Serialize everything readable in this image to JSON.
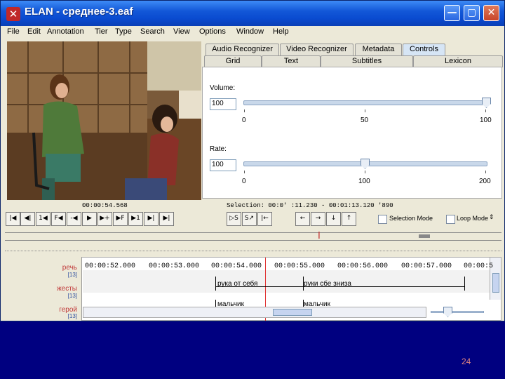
{
  "window": {
    "title": "ELAN - среднее-3.eaf",
    "app_icon": "elan-icon"
  },
  "window_controls": {
    "minimize": "—",
    "maximize": "▢",
    "close": "✕"
  },
  "menu": [
    "File",
    "Edit",
    "Annotation",
    "Tier",
    "Type",
    "Search",
    "View",
    "Options",
    "Window",
    "Help"
  ],
  "tabs_row1": [
    "Audio Recognizer",
    "Video Recognizer",
    "Metadata",
    "Controls"
  ],
  "tabs_row2": [
    "Grid",
    "Text",
    "Subtitles",
    "Lexicon"
  ],
  "active_tab": "Controls",
  "controls": {
    "volume_label": "Volume:",
    "volume_value": "100",
    "volume_ticks": [
      "0",
      "50",
      "100"
    ],
    "volume_fraction": 1.0,
    "rate_label": "Rate:",
    "rate_value": "100",
    "rate_ticks": [
      "0",
      "100",
      "200"
    ],
    "rate_fraction": 0.5
  },
  "status": {
    "time": "00:00:54.568",
    "selection": "Selection: 00:0' :11.230 - 00:01:13.120  '890"
  },
  "player_buttons": [
    "|◀",
    "◀|",
    "1◀",
    "F◀",
    "-◀",
    "▶",
    "▶+",
    "▶F",
    "▶1",
    "▶|",
    "▶|"
  ],
  "selection_buttons": [
    "▷S",
    "S↗",
    "|←"
  ],
  "nav_buttons": [
    "←",
    "→",
    "↓",
    "↑"
  ],
  "selection_mode_label": "Selection Mode",
  "loop_mode_label": "Loop Mode",
  "timeline": {
    "times": [
      "00:00:52.000",
      "00:00:53.000",
      "00:00:54.000",
      "00:00:55.000",
      "00:00:56.000",
      "00:00:57.000",
      "00:00:5"
    ],
    "tiers": [
      {
        "name": "речь",
        "count": "[13]"
      },
      {
        "name": "жесты",
        "count": "[13]"
      },
      {
        "name": "герой",
        "count": "[13]"
      }
    ],
    "annotations": [
      {
        "tier": "жесты",
        "text": "рука от себя"
      },
      {
        "tier": "жесты",
        "text": "руки сбе знизa"
      },
      {
        "tier": "герой",
        "text": "мальчик"
      },
      {
        "tier": "герой",
        "text": "мальчик"
      }
    ]
  },
  "slide_number": "24"
}
